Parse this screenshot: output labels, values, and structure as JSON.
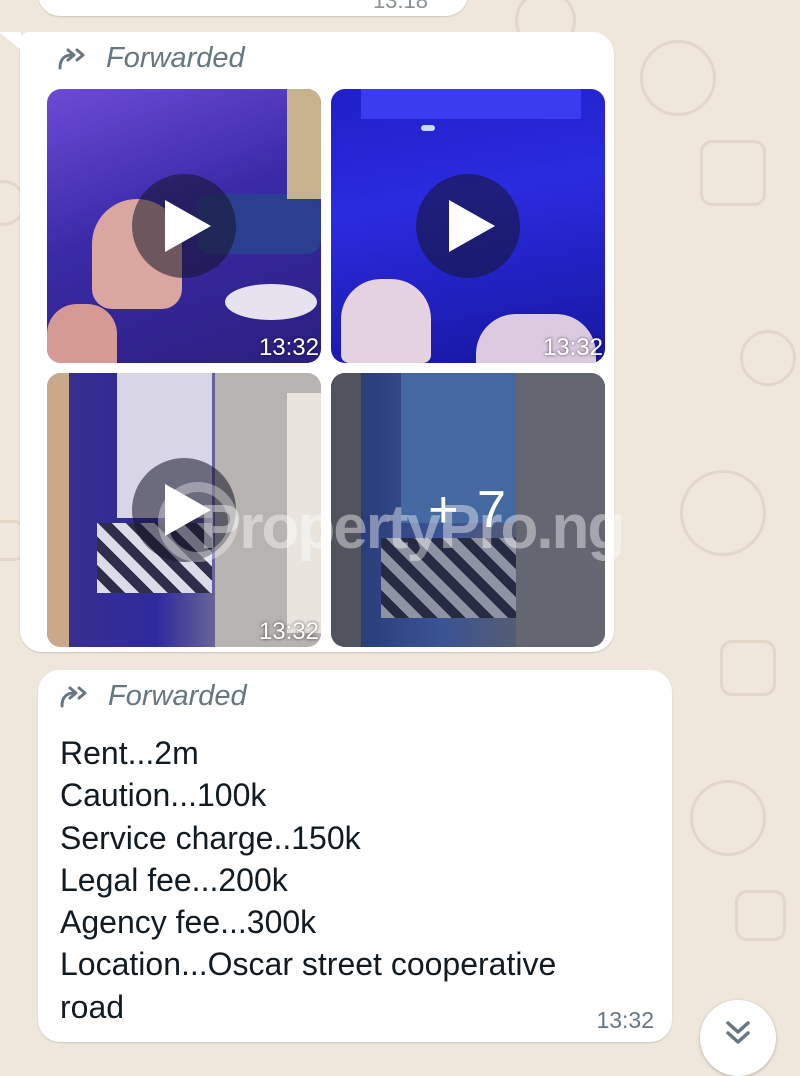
{
  "previous_message": {
    "time": "13:18"
  },
  "media_message": {
    "forwarded_label": "Forwarded",
    "tiles": [
      {
        "kind": "video",
        "time": "13:32"
      },
      {
        "kind": "video",
        "time": "13:32"
      },
      {
        "kind": "video",
        "time": "13:32"
      },
      {
        "kind": "more",
        "more_label": "+ 7"
      }
    ],
    "watermark": "PropertyPro.ng"
  },
  "text_message": {
    "forwarded_label": "Forwarded",
    "lines": [
      "Rent...2m",
      "Caution...100k",
      "Service charge..150k",
      "Legal fee...200k",
      "Agency fee...300k",
      "Location...Oscar street cooperative",
      "road"
    ],
    "time": "13:32"
  },
  "icons": {
    "forward": "forward-icon",
    "play": "play-icon",
    "scroll_down": "chevron-double-down-icon"
  },
  "colors": {
    "wallpaper": "#efe7dc",
    "bubble": "#ffffff",
    "meta_text": "#667781"
  }
}
